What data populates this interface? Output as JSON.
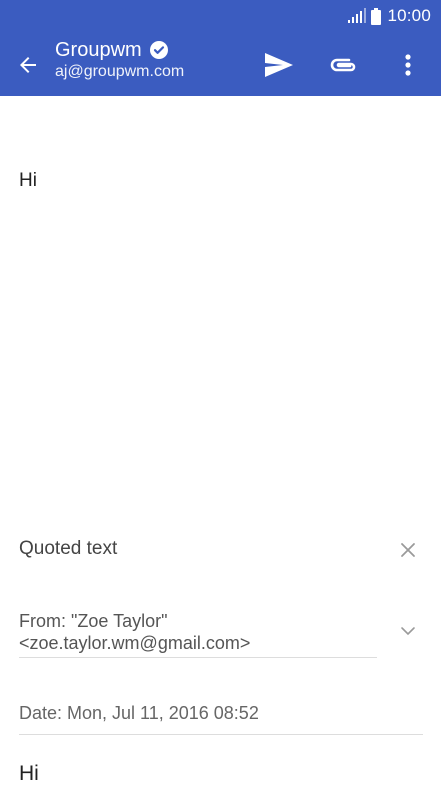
{
  "status_bar": {
    "time": "10:00",
    "signal_icon": "signal-icon",
    "battery_icon": "battery-icon"
  },
  "app_bar": {
    "account_name": "Groupwm",
    "account_email": "aj@groupwm.com",
    "back_icon": "arrow-back-icon",
    "verified_icon": "check-circle-icon",
    "send_icon": "send-icon",
    "attach_icon": "paperclip-icon",
    "menu_icon": "more-vert-icon",
    "color": "#3b5cc0"
  },
  "compose": {
    "body": "Hi"
  },
  "quoted": {
    "header": "Quoted text",
    "from_line1": "From: \"Zoe Taylor\"",
    "from_line2": "<zoe.taylor.wm@gmail.com>",
    "date": "Date: Mon, Jul 11, 2016 08:52",
    "body": "Hi"
  }
}
